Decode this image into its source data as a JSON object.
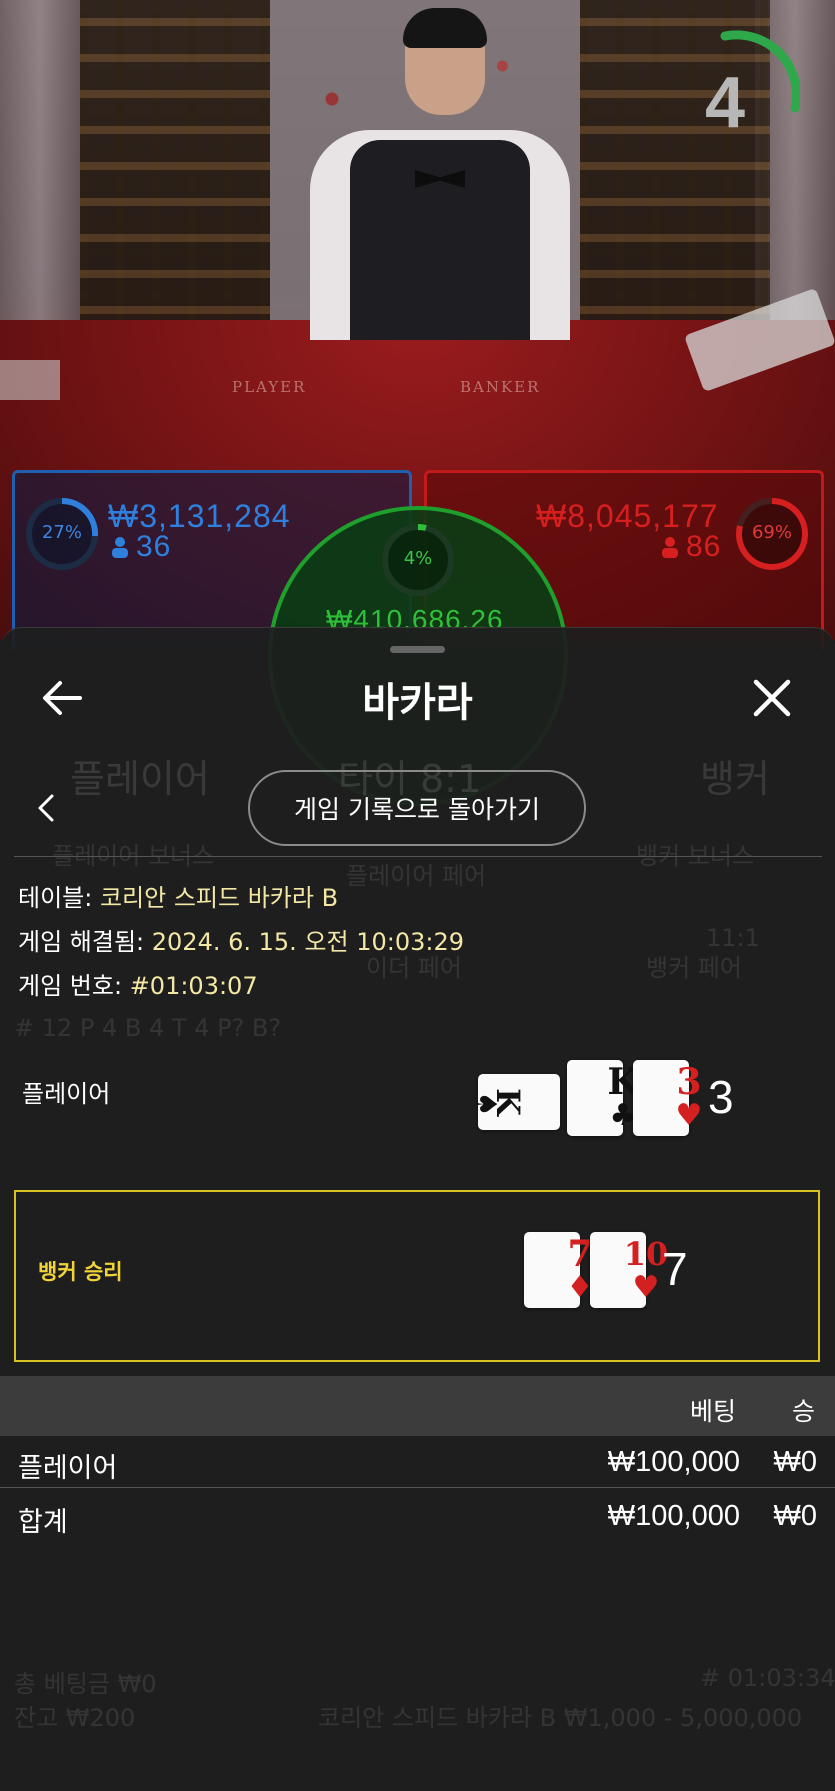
{
  "live": {
    "countdown": "4",
    "felt_player": "PLAYER",
    "felt_banker": "BANKER",
    "player": {
      "pct": "27%",
      "amount": "₩3,131,284",
      "count": "36"
    },
    "banker": {
      "pct": "69%",
      "amount": "₩8,045,177",
      "count": "86"
    },
    "tie": {
      "pct": "4%",
      "amount": "₩410,686.26"
    }
  },
  "background_ghost": {
    "player": "플레이어",
    "tie": "타이 8:1",
    "banker": "뱅커",
    "player_bonus": "플레이어 보너스",
    "player_pair": "플레이어 페어",
    "banker_bonus": "뱅커 보너스",
    "either_pair": "이더 페어",
    "banker_pair_odds": "11:1",
    "banker_pair": "뱅커 페어",
    "stats": "# 12   P 4   B 4   T 4        P?        B?",
    "total_bet": "총 베팅금 ₩0",
    "balance": "잔고 ₩200",
    "table_limits": "코리안 스피드 바카라 B ₩1,000 - 5,000,000",
    "round_id": "# 01:03:34"
  },
  "sheet": {
    "title": "바카라",
    "return_button": "게임 기록으로 돌아가기",
    "info": {
      "table_label": "테이블:",
      "table_value": "코리안 스피드 바카라 B",
      "resolved_label": "게임 해결됨:",
      "resolved_value": "2024. 6. 15. 오전 10:03:29",
      "round_label": "게임 번호:",
      "round_value": "#01:03:07"
    },
    "hands": {
      "player": {
        "label": "플레이어",
        "score": "3",
        "cards": [
          {
            "rank": "K",
            "suit": "♠",
            "color": "black",
            "sideways": true
          },
          {
            "rank": "K",
            "suit": "♣",
            "color": "black",
            "sideways": false
          },
          {
            "rank": "3",
            "suit": "♥",
            "color": "red",
            "sideways": false
          }
        ]
      },
      "banker": {
        "label": "뱅커 승리",
        "score": "7",
        "cards": [
          {
            "rank": "7",
            "suit": "♦",
            "color": "red",
            "sideways": false
          },
          {
            "rank": "10",
            "suit": "♥",
            "color": "red",
            "sideways": false
          }
        ]
      }
    },
    "bets": {
      "header_bet": "베팅",
      "header_win": "승",
      "rows": [
        {
          "name": "플레이어",
          "bet": "₩100,000",
          "win": "₩0"
        },
        {
          "name": "합계",
          "bet": "₩100,000",
          "win": "₩0"
        }
      ]
    }
  },
  "colors": {
    "player_blue": "#2f7fdc",
    "banker_red": "#d81f1f",
    "tie_green": "#2fbf3a",
    "winner_border": "#d8c21e",
    "info_value": "#f3e7a6"
  },
  "icons": [
    "back-arrow-icon",
    "close-icon",
    "chevron-left-icon",
    "person-icon"
  ]
}
